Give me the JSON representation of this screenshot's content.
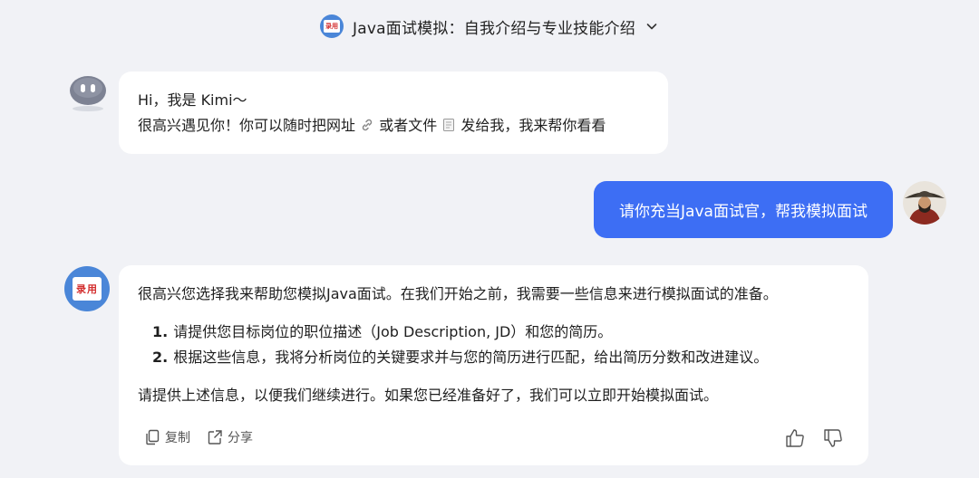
{
  "header": {
    "title": "Java面试模拟：自我介绍与专业技能介绍",
    "avatar_text": "录用"
  },
  "messages": {
    "greeting": {
      "line1": "Hi，我是 Kimi～",
      "line2_a": "很高兴遇见你！你可以随时把网址",
      "line2_b": "或者文件",
      "line2_c": "发给我，我来帮你看看"
    },
    "user": {
      "text": "请你充当Java面试官，帮我模拟面试"
    },
    "reply": {
      "avatar_text": "录用",
      "intro": "很高兴您选择我来帮助您模拟Java面试。在我们开始之前，我需要一些信息来进行模拟面试的准备。",
      "items": [
        {
          "num": "1.",
          "text": "请提供您目标岗位的职位描述（Job Description, JD）和您的简历。"
        },
        {
          "num": "2.",
          "text": "根据这些信息，我将分析岗位的关键要求并与您的简历进行匹配，给出简历分数和改进建议。"
        }
      ],
      "outro": "请提供上述信息，以便我们继续进行。如果您已经准备好了，我们可以立即开始模拟面试。",
      "copy_label": "复制",
      "share_label": "分享"
    }
  },
  "colors": {
    "background": "#f1f2f6",
    "user_bubble": "#3d6ef4",
    "avatar_blue": "#4a86d8"
  }
}
